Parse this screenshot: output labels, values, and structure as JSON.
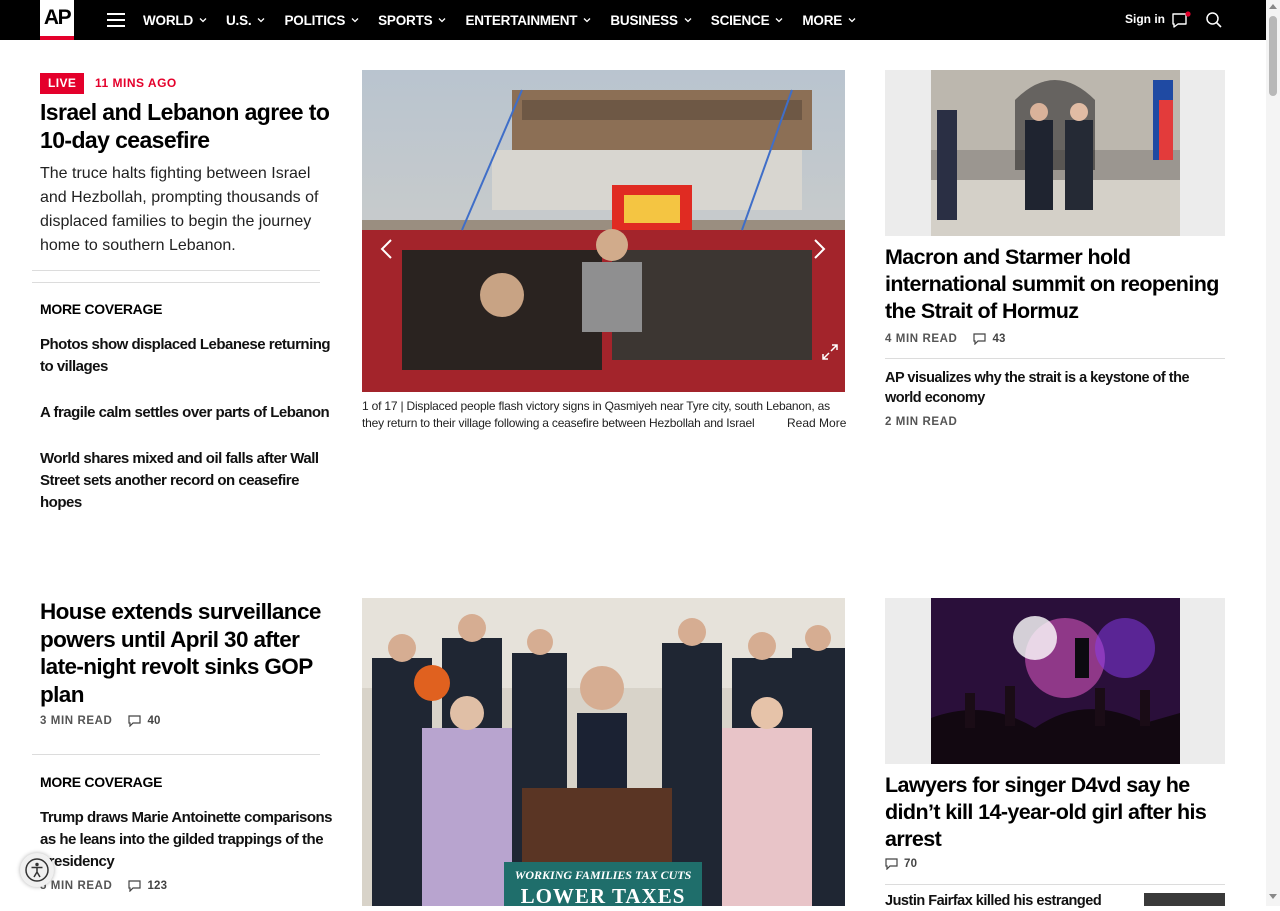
{
  "nav": {
    "logo": "AP",
    "items": [
      "WORLD",
      "U.S.",
      "POLITICS",
      "SPORTS",
      "ENTERTAINMENT",
      "BUSINESS",
      "SCIENCE",
      "MORE"
    ],
    "sign_in": "Sign in",
    "icons": [
      "menu-icon",
      "chat-icon",
      "search-icon"
    ]
  },
  "story1": {
    "badge": "LIVE",
    "time": "11 MINS AGO",
    "headline": "Israel and Lebanon agree to 10-day ceasefire",
    "summary": "The truce halts fighting between Israel and Hezbollah, prompting thousands of displaced families to begin the journey home to southern Lebanon.",
    "more_label": "MORE COVERAGE",
    "links": [
      "Photos show displaced Lebanese returning to villages",
      "A fragile calm settles over parts of Lebanon",
      "World shares mixed and oil falls after Wall Street sets another record on ceasefire hopes"
    ]
  },
  "carousel": {
    "counter": "1 of 17",
    "caption": "Displaced people flash victory signs in Qasmiyeh near Tyre city, south Lebanon, as they return to their village following a ceasefire between Hezbollah and Israel",
    "read_more": "Read More"
  },
  "right1": {
    "headline": "Macron and Starmer hold international summit on reopening the Strait of Hormuz",
    "read_time": "4 MIN READ",
    "comments": "43",
    "sub_headline": "AP visualizes why the strait is a keystone of the world economy",
    "sub_read_time": "2 MIN READ"
  },
  "story2": {
    "headline": "House extends surveillance powers until April 30 after late-night revolt sinks GOP plan",
    "read_time": "3 MIN READ",
    "comments": "40",
    "more_label": "MORE COVERAGE",
    "link": "Trump draws Marie Antoinette comparisons as he leans into the gilded trappings of the presidency",
    "link_read_time": "5 MIN READ",
    "link_comments": "123"
  },
  "center2": {
    "sign_line1": "WORKING FAMILIES TAX CUTS",
    "sign_line2": "LOWER TAXES"
  },
  "right2": {
    "headline": "Lawyers for singer D4vd say he didn’t kill 14-year-old girl after his arrest",
    "comments": "70",
    "sub_headline": "Justin Fairfax killed his estranged"
  },
  "colors": {
    "accent": "#e4002b",
    "nav_bg": "#000000"
  }
}
